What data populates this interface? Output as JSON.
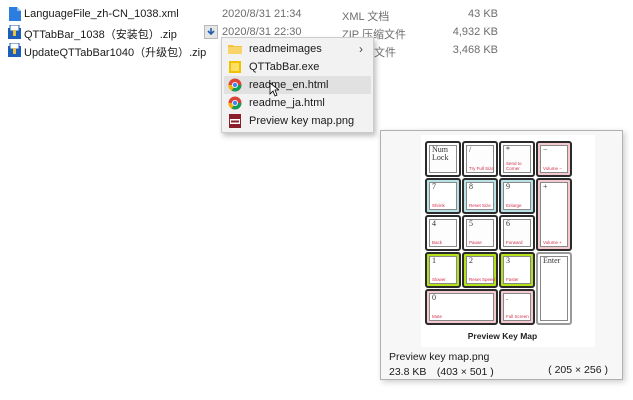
{
  "files": [
    {
      "name": "LanguageFile_zh-CN_1038.xml",
      "date": "2020/8/31 21:34",
      "type": "XML 文档",
      "size": "43 KB",
      "icon": "xml-file-icon"
    },
    {
      "name": "QTTabBar_1038（安装包）.zip",
      "date": "2020/8/31 22:30",
      "type": "ZIP 压缩文件",
      "size": "4,932 KB",
      "icon": "zip-archive-icon"
    },
    {
      "name": "UpdateQTTabBar1040（升级包）.zip",
      "date": "",
      "type": "缩文件",
      "size": "3,468 KB",
      "icon": "zip-archive-icon"
    }
  ],
  "context_menu": {
    "items": [
      {
        "label": "readmeimages",
        "icon": "folder-icon",
        "submenu": true
      },
      {
        "label": "QTTabBar.exe",
        "icon": "exe-icon"
      },
      {
        "label": "readme_en.html",
        "icon": "chrome-html-icon",
        "highlighted": true
      },
      {
        "label": "readme_ja.html",
        "icon": "chrome-html-icon"
      },
      {
        "label": "Preview key map.png",
        "icon": "png-image-icon"
      }
    ]
  },
  "preview": {
    "image_title": "Preview Key Map",
    "filename": "Preview key map.png",
    "size_info": "23.8 KB　(403 × 501 )",
    "display_size": "( 205 × 256 )",
    "keys": [
      {
        "label": "Num\nLock",
        "sub": "",
        "color": "gray"
      },
      {
        "label": "/",
        "sub": "Try Full Size",
        "color": "gray"
      },
      {
        "label": "*",
        "sub": "Send to Corner",
        "color": "gray"
      },
      {
        "label": "−",
        "sub": "Volume −",
        "color": "pink"
      },
      {
        "label": "7",
        "sub": "Shrink",
        "color": "cyan"
      },
      {
        "label": "8",
        "sub": "Reset Size",
        "color": "cyan"
      },
      {
        "label": "9",
        "sub": "Enlarge",
        "color": "cyan"
      },
      {
        "label": "+",
        "sub": "Volume +",
        "color": "pink"
      },
      {
        "label": "4",
        "sub": "Back",
        "color": "gray"
      },
      {
        "label": "5",
        "sub": "Pause",
        "color": "gray"
      },
      {
        "label": "6",
        "sub": "Forward",
        "color": "gray"
      },
      {
        "label": "1",
        "sub": "Slower",
        "color": "lime"
      },
      {
        "label": "2",
        "sub": "Reset Speed",
        "color": "lime"
      },
      {
        "label": "3",
        "sub": "Faster",
        "color": "lime"
      },
      {
        "label": "Enter",
        "sub": "",
        "color": "light"
      },
      {
        "label": "0",
        "sub": "Mute",
        "color": "pink"
      },
      {
        "label": ".",
        "sub": "Full Screen",
        "color": "pink"
      }
    ]
  },
  "colors": {
    "accent": "#1e7fd6",
    "highlight": "#e1e1e1",
    "pink": "#f4c9cf",
    "cyan": "#b9e3e6",
    "lime": "#b6e21a"
  }
}
